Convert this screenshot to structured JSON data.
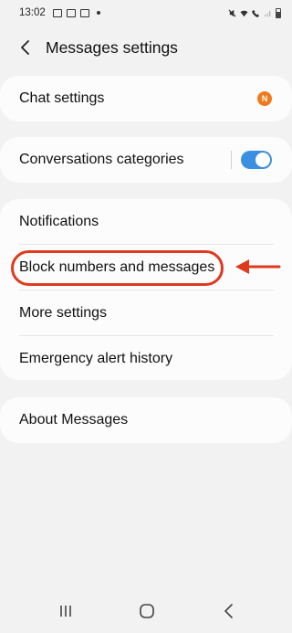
{
  "status_bar": {
    "time": "13:02"
  },
  "header": {
    "title": "Messages settings"
  },
  "cards": {
    "chat": {
      "label": "Chat settings",
      "badge": "N"
    },
    "categories": {
      "label": "Conversations categories",
      "toggle_on": true
    },
    "main": {
      "items": [
        {
          "label": "Notifications"
        },
        {
          "label": "Block numbers and messages"
        },
        {
          "label": "More settings"
        },
        {
          "label": "Emergency alert history"
        }
      ]
    },
    "about": {
      "label": "About Messages"
    }
  },
  "colors": {
    "accent": "#3a8fe0",
    "badge": "#f07a1c",
    "annotation": "#e03a1e",
    "background": "#f2f2f2",
    "card": "#fcfcfc"
  }
}
